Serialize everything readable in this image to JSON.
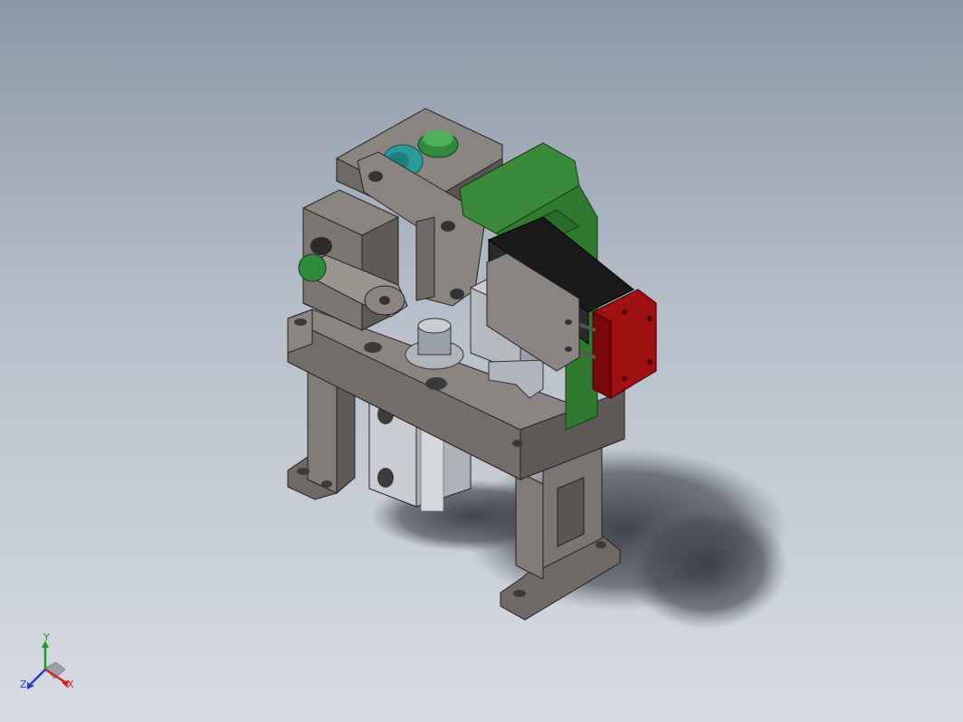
{
  "viewport": {
    "background_top": "#8c98a8",
    "background_bottom": "#d7dce3"
  },
  "model": {
    "base_color": "#7d7873",
    "cylinder_color": "#c9ccd2",
    "clamp_green": "#3a8a3a",
    "knob_green": "#2f8a3c",
    "teal_wheel": "#2a9a9a",
    "motor_black": "#1a1a1a",
    "motor_cap_red": "#a01010"
  },
  "triad": {
    "x_label": "X",
    "y_label": "Y",
    "z_label": "Z",
    "x_color": "#d22020",
    "y_color": "#1f9a2a",
    "z_color": "#2a3ad2"
  }
}
